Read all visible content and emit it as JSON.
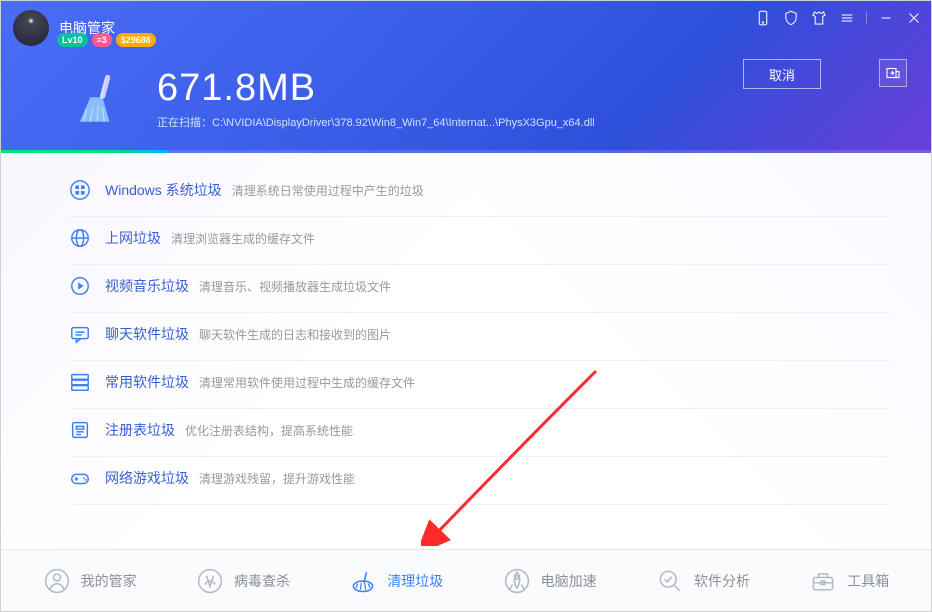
{
  "app": {
    "title": "电脑管家"
  },
  "badges": {
    "level": "Lv10",
    "b2": "≡3",
    "b3": "$29688"
  },
  "scan": {
    "size": "671.8MB",
    "prefix": "正在扫描：",
    "path": "C:\\NVIDIA\\DisplayDriver\\378.92\\Win8_Win7_64\\Internat...\\PhysX3Gpu_x64.dll",
    "cancel": "取消"
  },
  "categories": [
    {
      "title": "Windows 系统垃圾",
      "desc": "清理系统日常使用过程中产生的垃圾",
      "icon": "windows"
    },
    {
      "title": "上网垃圾",
      "desc": "清理浏览器生成的缓存文件",
      "icon": "globe"
    },
    {
      "title": "视频音乐垃圾",
      "desc": "清理音乐、视频播放器生成垃圾文件",
      "icon": "play"
    },
    {
      "title": "聊天软件垃圾",
      "desc": "聊天软件生成的日志和接收到的图片",
      "icon": "chat"
    },
    {
      "title": "常用软件垃圾",
      "desc": "清理常用软件使用过程中生成的缓存文件",
      "icon": "stack"
    },
    {
      "title": "注册表垃圾",
      "desc": "优化注册表结构，提高系统性能",
      "icon": "registry"
    },
    {
      "title": "网络游戏垃圾",
      "desc": "清理游戏残留，提升游戏性能",
      "icon": "game"
    }
  ],
  "nav": [
    {
      "label": "我的管家",
      "icon": "user"
    },
    {
      "label": "病毒查杀",
      "icon": "virus"
    },
    {
      "label": "清理垃圾",
      "icon": "clean",
      "active": true
    },
    {
      "label": "电脑加速",
      "icon": "rocket"
    },
    {
      "label": "软件分析",
      "icon": "analyze"
    },
    {
      "label": "工具箱",
      "icon": "toolbox"
    }
  ],
  "colors": {
    "primary": "#3b5ee8",
    "link": "#3760d4",
    "muted": "#8a8f99"
  }
}
